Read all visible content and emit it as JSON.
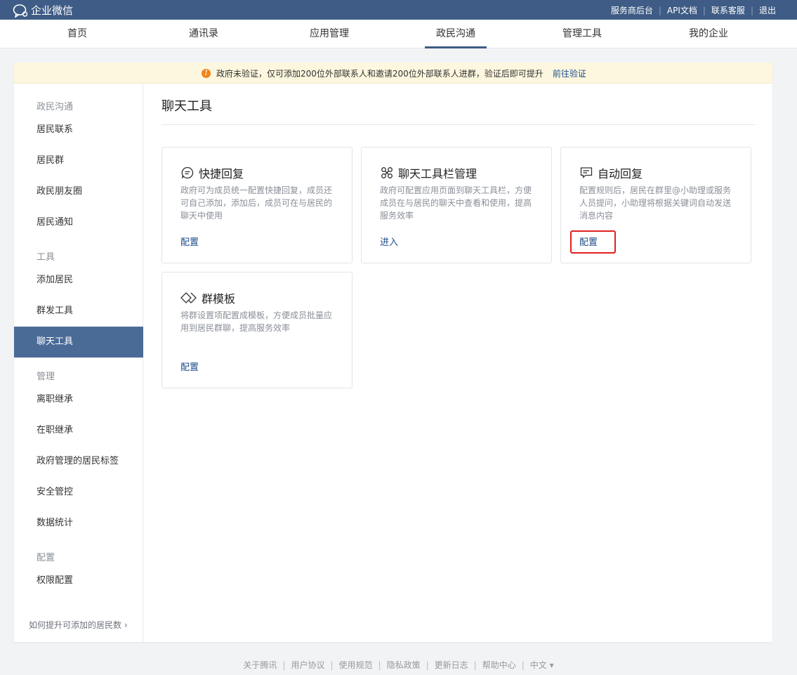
{
  "topbar": {
    "logo_text": "企业微信",
    "links": [
      "服务商后台",
      "API文档",
      "联系客服",
      "退出"
    ]
  },
  "nav": {
    "items": [
      "首页",
      "通讯录",
      "应用管理",
      "政民沟通",
      "管理工具",
      "我的企业"
    ],
    "active": "政民沟通"
  },
  "notice": {
    "text": "政府未验证，仅可添加200位外部联系人和邀请200位外部联系人进群，验证后即可提升",
    "link": "前往验证"
  },
  "sidebar": {
    "groups": [
      {
        "title": "政民沟通",
        "items": [
          "居民联系",
          "居民群",
          "政民朋友圈",
          "居民通知"
        ]
      },
      {
        "title": "工具",
        "items": [
          "添加居民",
          "群发工具",
          "聊天工具"
        ]
      },
      {
        "title": "管理",
        "items": [
          "离职继承",
          "在职继承",
          "政府管理的居民标签",
          "安全管控",
          "数据统计"
        ]
      },
      {
        "title": "配置",
        "items": [
          "权限配置"
        ]
      }
    ],
    "active": "聊天工具",
    "footer": "如何提升可添加的居民数"
  },
  "content": {
    "title": "聊天工具",
    "tools": [
      {
        "icon": "quick-reply-icon",
        "title": "快捷回复",
        "desc": "政府可为成员统一配置快捷回复，成员还可自己添加，添加后，成员可在与居民的聊天中使用",
        "action": "配置"
      },
      {
        "icon": "toolbar-icon",
        "title": "聊天工具栏管理",
        "desc": "政府可配置应用页面到聊天工具栏，方便成员在与居民的聊天中查看和使用，提高服务效率",
        "action": "进入"
      },
      {
        "icon": "auto-reply-icon",
        "title": "自动回复",
        "desc": "配置规则后，居民在群里@小助理或服务人员提问，小助理将根据关键词自动发送消息内容",
        "action": "配置"
      },
      {
        "icon": "group-template-icon",
        "title": "群模板",
        "desc": "将群设置项配置成模板，方便成员批量应用到居民群聊，提高服务效率",
        "action": "配置"
      }
    ]
  },
  "footer": {
    "links": [
      "关于腾讯",
      "用户协议",
      "使用规范",
      "隐私政策",
      "更新日志",
      "帮助中心"
    ],
    "language": "中文 ▾"
  },
  "colors": {
    "topbar": "#3e5c85",
    "active_sidebar": "#4b6b97",
    "link": "#1f4d8a",
    "highlight_box": "#e02020",
    "warning": "#f08519"
  }
}
